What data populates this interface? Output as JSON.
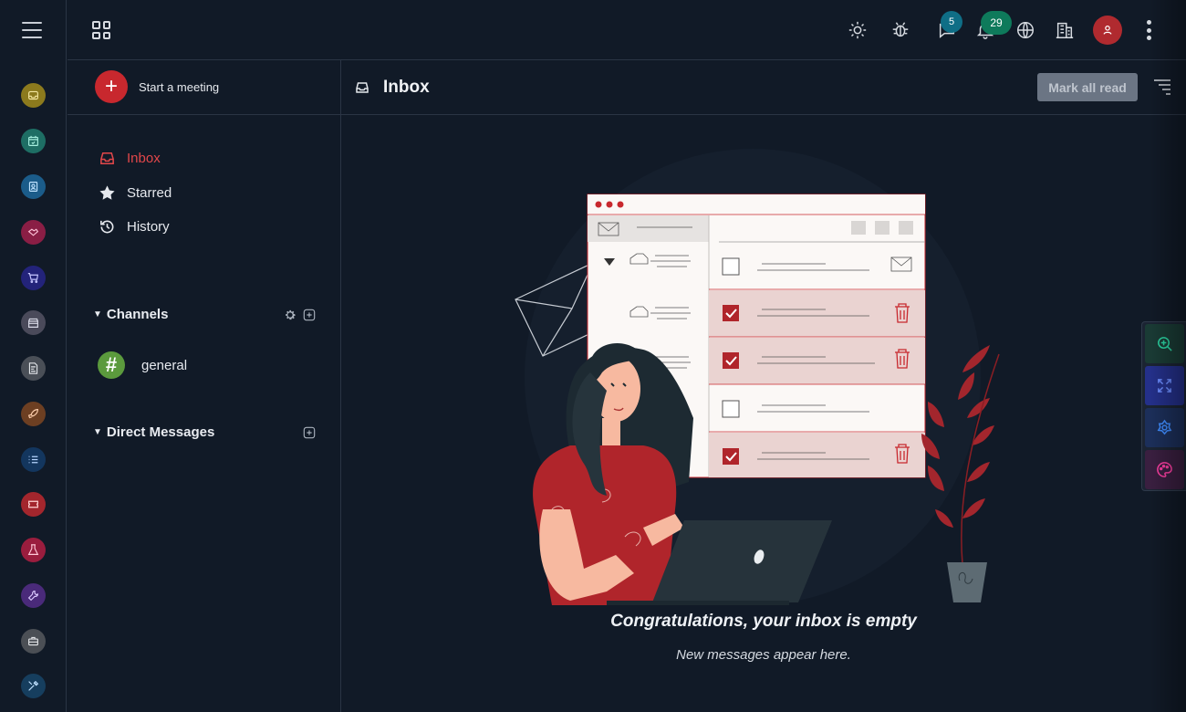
{
  "header": {
    "badges": {
      "chat_count": "5",
      "notification_count": "29"
    }
  },
  "sidebar": {
    "start_meeting_label": "Start a meeting",
    "nav": [
      {
        "label": "Inbox",
        "icon": "inbox-icon",
        "active": true
      },
      {
        "label": "Starred",
        "icon": "star-icon"
      },
      {
        "label": "History",
        "icon": "history-icon"
      }
    ],
    "channels": {
      "title": "Channels",
      "items": [
        {
          "name": "general",
          "icon": "#"
        }
      ]
    },
    "direct_messages": {
      "title": "Direct Messages"
    }
  },
  "main": {
    "title": "Inbox",
    "mark_all_read_label": "Mark all read",
    "empty_title": "Congratulations, your inbox is empty",
    "empty_subtitle": "New messages appear here."
  },
  "rail_apps": [
    {
      "name": "inbox-app-icon",
      "color": "#8c7a1d"
    },
    {
      "name": "calendar-app-icon",
      "color": "#1e6e64"
    },
    {
      "name": "contacts-app-icon",
      "color": "#1b5c8a"
    },
    {
      "name": "crm-app-icon",
      "color": "#8a1e45"
    },
    {
      "name": "shop-app-icon",
      "color": "#23237a"
    },
    {
      "name": "store-app-icon",
      "color": "#4a4a5a"
    },
    {
      "name": "invoice-app-icon",
      "color": "#4a4f57"
    },
    {
      "name": "rocket-app-icon",
      "color": "#6d3f22"
    },
    {
      "name": "tasks-app-icon",
      "color": "#13365e"
    },
    {
      "name": "ticket-app-icon",
      "color": "#a3262d"
    },
    {
      "name": "lab-app-icon",
      "color": "#9a1d3e"
    },
    {
      "name": "tools-app-icon",
      "color": "#4a2a7a"
    },
    {
      "name": "briefcase-app-icon",
      "color": "#4b4f55"
    },
    {
      "name": "settings-app-icon",
      "color": "#163e5e"
    }
  ],
  "colors": {
    "accent": "#c8282e",
    "background": "#111a27",
    "active_nav": "#e2474a"
  }
}
